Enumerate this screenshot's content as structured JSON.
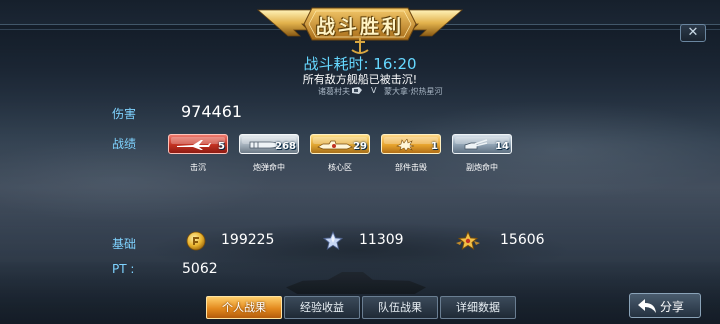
{
  "banner": {
    "title": "战斗胜利"
  },
  "battle": {
    "time_label": "战斗耗时:",
    "time_value": "16:20",
    "result_text": "所有敌方舰船已被击沉!",
    "player_left": "诸葛村夫",
    "vs": "V",
    "player_right": "蒙大拿·炽热星河"
  },
  "stats": {
    "damage_label": "伤害",
    "damage_value": "974461",
    "record_label": "战绩",
    "medals": [
      {
        "label": "击沉",
        "count": "5",
        "icon": "plane-icon",
        "color": "#c23222"
      },
      {
        "label": "炮弹命中",
        "count": "268",
        "icon": "shell-icon",
        "color": "#a3b0bb"
      },
      {
        "label": "核心区",
        "count": "29",
        "icon": "core-zone-icon",
        "color": "#e0a531"
      },
      {
        "label": "部件击毁",
        "count": "1",
        "icon": "explosion-icon",
        "color": "#e7a42e"
      },
      {
        "label": "副炮命中",
        "count": "14",
        "icon": "secondary-gun-icon",
        "color": "#8fa2b3"
      }
    ],
    "base_label": "基础",
    "resources": [
      {
        "icon": "gold-coin-icon",
        "value": "199225"
      },
      {
        "icon": "silver-star-icon",
        "value": "11309"
      },
      {
        "icon": "gold-star-icon",
        "value": "15606"
      }
    ],
    "pt_label": "PT :",
    "pt_value": "5062"
  },
  "tabs": [
    {
      "label": "个人战果",
      "active": true
    },
    {
      "label": "经验收益",
      "active": false
    },
    {
      "label": "队伍战果",
      "active": false
    },
    {
      "label": "详细数据",
      "active": false
    }
  ],
  "share": {
    "label": "分享"
  },
  "colors": {
    "accent": "#66d8ff",
    "label": "#7fd3ff",
    "gold": "#e38a1e"
  }
}
